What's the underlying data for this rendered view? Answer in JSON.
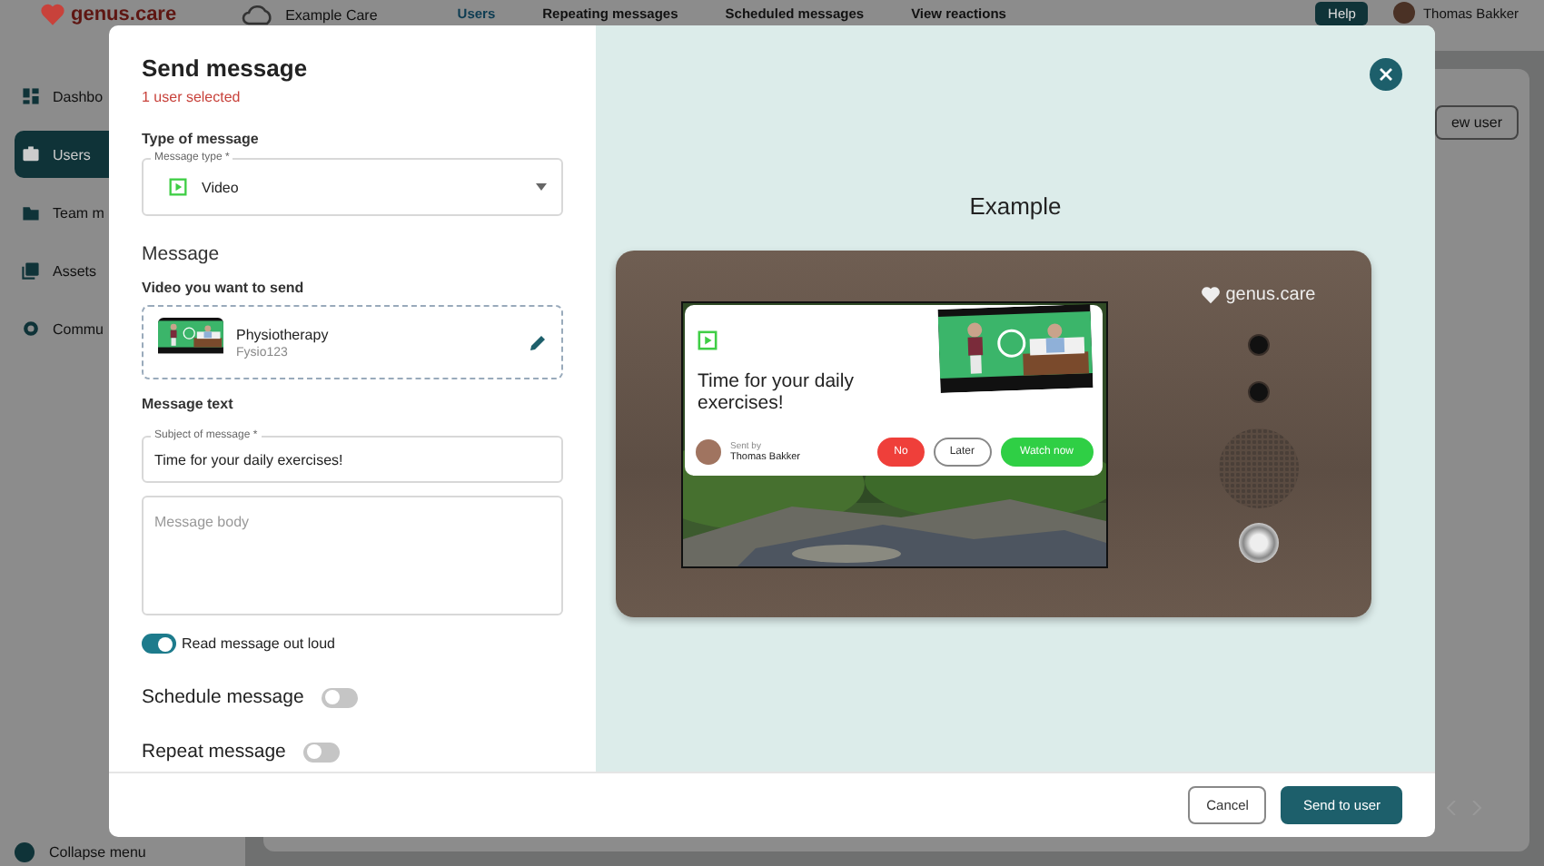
{
  "app_header": {
    "logo": "genus.care",
    "organization": "Example Care",
    "nav": [
      {
        "label": "Users",
        "selected": true
      },
      {
        "label": "Repeating messages",
        "selected": false
      },
      {
        "label": "Scheduled messages",
        "selected": false
      },
      {
        "label": "View reactions",
        "selected": false
      }
    ],
    "help_button": "Help",
    "user_name": "Thomas Bakker"
  },
  "sidebar": {
    "items": [
      {
        "label": "Dashbo",
        "selected": false
      },
      {
        "label": "Users",
        "selected": true
      },
      {
        "label": "Team m",
        "selected": false
      },
      {
        "label": "Assets",
        "selected": false
      },
      {
        "label": "Commu",
        "selected": false
      }
    ],
    "collapse": "Collapse menu"
  },
  "background_button": "ew user",
  "dialog": {
    "title": "Send message",
    "subtitle": "1 user selected",
    "type_section": "Type of message",
    "message_type": {
      "label": "Message type *",
      "value": "Video"
    },
    "message_heading": "Message",
    "video_label": "Video you want to send",
    "video": {
      "title": "Physiotherapy",
      "code": "Fysio123"
    },
    "text_label": "Message text",
    "subject": {
      "label": "Subject of message *",
      "value": "Time for your daily exercises!"
    },
    "body": {
      "placeholder": "Message body"
    },
    "toggles": [
      {
        "label": "Read message out loud",
        "on": true,
        "kind": "small"
      },
      {
        "label": "Schedule message",
        "on": false,
        "kind": "large"
      },
      {
        "label": "Repeat message",
        "on": false,
        "kind": "large"
      }
    ],
    "preview": {
      "title": "Example",
      "brand": "genus.care",
      "card_title": "Time for your daily exercises!",
      "sent_by": "Sent by",
      "sender": "Thomas Bakker",
      "buttons": [
        {
          "label": "No",
          "kind": "decline"
        },
        {
          "label": "Later",
          "kind": "outline"
        },
        {
          "label": "Watch now",
          "kind": "accept"
        }
      ]
    },
    "buttons": [
      {
        "label": "Cancel",
        "kind": "secondary"
      },
      {
        "label": "Send to user",
        "kind": "primary"
      }
    ]
  }
}
